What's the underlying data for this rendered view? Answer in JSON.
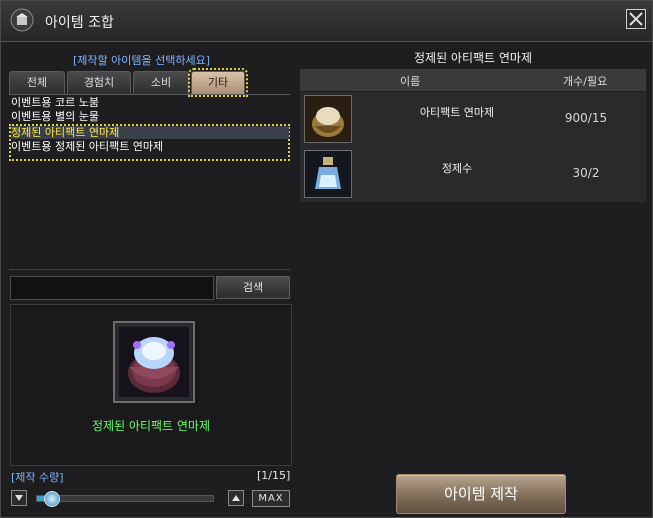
{
  "window": {
    "title": "아이템 조합",
    "icon": "crafting-icon",
    "close_icon": "close-icon"
  },
  "left_panel": {
    "header": "[제작할 아이템을 선택하세요]",
    "tabs": [
      {
        "label": "전체",
        "active": false
      },
      {
        "label": "경험치",
        "active": false
      },
      {
        "label": "소비",
        "active": false
      },
      {
        "label": "기타",
        "active": true
      }
    ],
    "items": [
      {
        "label": "이벤트용 코르 노붐",
        "selected": false
      },
      {
        "label": "이벤트용 별의 눈물",
        "selected": false
      },
      {
        "label": "정제된 아티팩트 연마제",
        "selected": true
      },
      {
        "label": "이벤트용 정제된 아티팩트 연마제",
        "selected": false
      }
    ],
    "search": {
      "value": "",
      "button_label": "검색"
    },
    "preview": {
      "name": "정제된 아티팩트 연마제",
      "icon": "artifact-polish-pouch-icon"
    },
    "quantity": {
      "label": "[제작 수량]",
      "count_text": "[1/15]",
      "level": 0.04,
      "max_label": "MAX"
    }
  },
  "right_panel": {
    "title": "정제된 아티팩트 연마제",
    "columns": {
      "name": "이름",
      "count": "개수/필요"
    },
    "materials": [
      {
        "name": "아티팩트 연마제",
        "count": "900/15",
        "icon": "artifact-polish-icon"
      },
      {
        "name": "정제수",
        "count": "30/2",
        "icon": "purified-water-bottle-icon"
      }
    ],
    "craft_button": "아이템 제작"
  },
  "colors": {
    "accent_blue": "#7fb2ff",
    "selection_yellow": "#ffee44",
    "preview_green": "#66ff66",
    "craft_button": "#8f7c66"
  }
}
